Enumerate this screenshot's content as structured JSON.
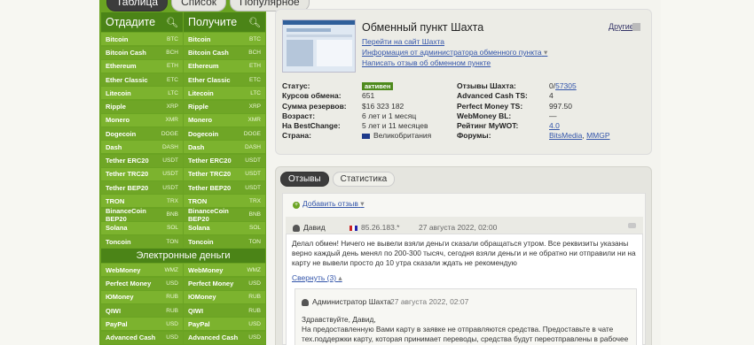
{
  "top_tabs": [
    {
      "label": "Таблица",
      "active": true
    },
    {
      "label": "Список",
      "active": false
    },
    {
      "label": "Популярное",
      "active": false
    }
  ],
  "give_header": "Отдадите",
  "get_header": "Получите",
  "currencies": [
    {
      "name": "Bitcoin",
      "code": "BTC"
    },
    {
      "name": "Bitcoin Cash",
      "code": "BCH"
    },
    {
      "name": "Ethereum",
      "code": "ETH"
    },
    {
      "name": "Ether Classic",
      "code": "ETC"
    },
    {
      "name": "Litecoin",
      "code": "LTC"
    },
    {
      "name": "Ripple",
      "code": "XRP"
    },
    {
      "name": "Monero",
      "code": "XMR"
    },
    {
      "name": "Dogecoin",
      "code": "DOGE"
    },
    {
      "name": "Dash",
      "code": "DASH"
    },
    {
      "name": "Tether ERC20",
      "code": "USDT"
    },
    {
      "name": "Tether TRC20",
      "code": "USDT"
    },
    {
      "name": "Tether BEP20",
      "code": "USDT"
    },
    {
      "name": "TRON",
      "code": "TRX"
    },
    {
      "name": "BinanceCoin BEP20",
      "code": "BNB"
    },
    {
      "name": "Solana",
      "code": "SOL"
    },
    {
      "name": "Toncoin",
      "code": "TON"
    }
  ],
  "emoney_header": "Электронные деньги",
  "emoney": [
    {
      "name": "WebMoney",
      "code": "WMZ"
    },
    {
      "name": "Perfect Money",
      "code": "USD"
    },
    {
      "name": "ЮMoney",
      "code": "RUB"
    },
    {
      "name": "QIWI",
      "code": "RUB"
    },
    {
      "name": "PayPal",
      "code": "USD"
    },
    {
      "name": "Advanced Cash",
      "code": "USD"
    }
  ],
  "exchanger": {
    "title": "Обменный пункт Шахта",
    "others": "Другие",
    "links": [
      "Перейти на сайт Шахта",
      "Информация от администратора обменного пункта",
      "Написать отзыв об обменном пункте"
    ]
  },
  "stats_left": [
    {
      "k": "Статус:",
      "v": "активен"
    },
    {
      "k": "Курсов обмена:",
      "v": "651"
    },
    {
      "k": "Сумма резервов:",
      "v": "$16 323 182"
    },
    {
      "k": "Возраст:",
      "v": "6 лет и 1 месяц"
    },
    {
      "k": "На BestChange:",
      "v": "5 лет и 11 месяцев"
    },
    {
      "k": "Страна:",
      "v": "Великобритания"
    }
  ],
  "stats_right": [
    {
      "k": "Отзывы Шахта:",
      "v": "0/",
      "v2": "57305"
    },
    {
      "k": "Advanced Cash TS:",
      "v": "4"
    },
    {
      "k": "Perfect Money TS:",
      "v": "997.50"
    },
    {
      "k": "WebMoney BL:",
      "v": "—"
    },
    {
      "k": "Рейтинг MyWOT:",
      "v": "4.0"
    },
    {
      "k": "Форумы:",
      "v": "BitsMedia",
      "v2": "MMGP"
    }
  ],
  "review_tabs": [
    {
      "label": "Отзывы",
      "active": true
    },
    {
      "label": "Статистика",
      "active": false
    }
  ],
  "leave_review": "Добавить отзыв",
  "review": {
    "author": "Давид",
    "ip": "85.26.183.*",
    "date": "27 августа 2022, 02:00",
    "text": "Делал обмен! Ничего не вывели взяли деньги сказали обращаться утром. Все реквизиты указаны верно каждый день менял по 200-300 тысяч, сегодня взяли деньги и не обратно ни отправили ни на карту не вывели просто до 10 утра сказали ждать не рекомендую",
    "collapse": "Свернуть (3)"
  },
  "reply": {
    "author": "Администратор Шахта",
    "date": "27 августа 2022, 02:07",
    "greeting": "Здравствуйте, Давид,",
    "text": "На предоставленную Вами карту в заявке не отправляются средства. Предоставьте в чате тех.поддержки карту, которая принимает переводы, средства будут переотправлены в рабочее время."
  }
}
